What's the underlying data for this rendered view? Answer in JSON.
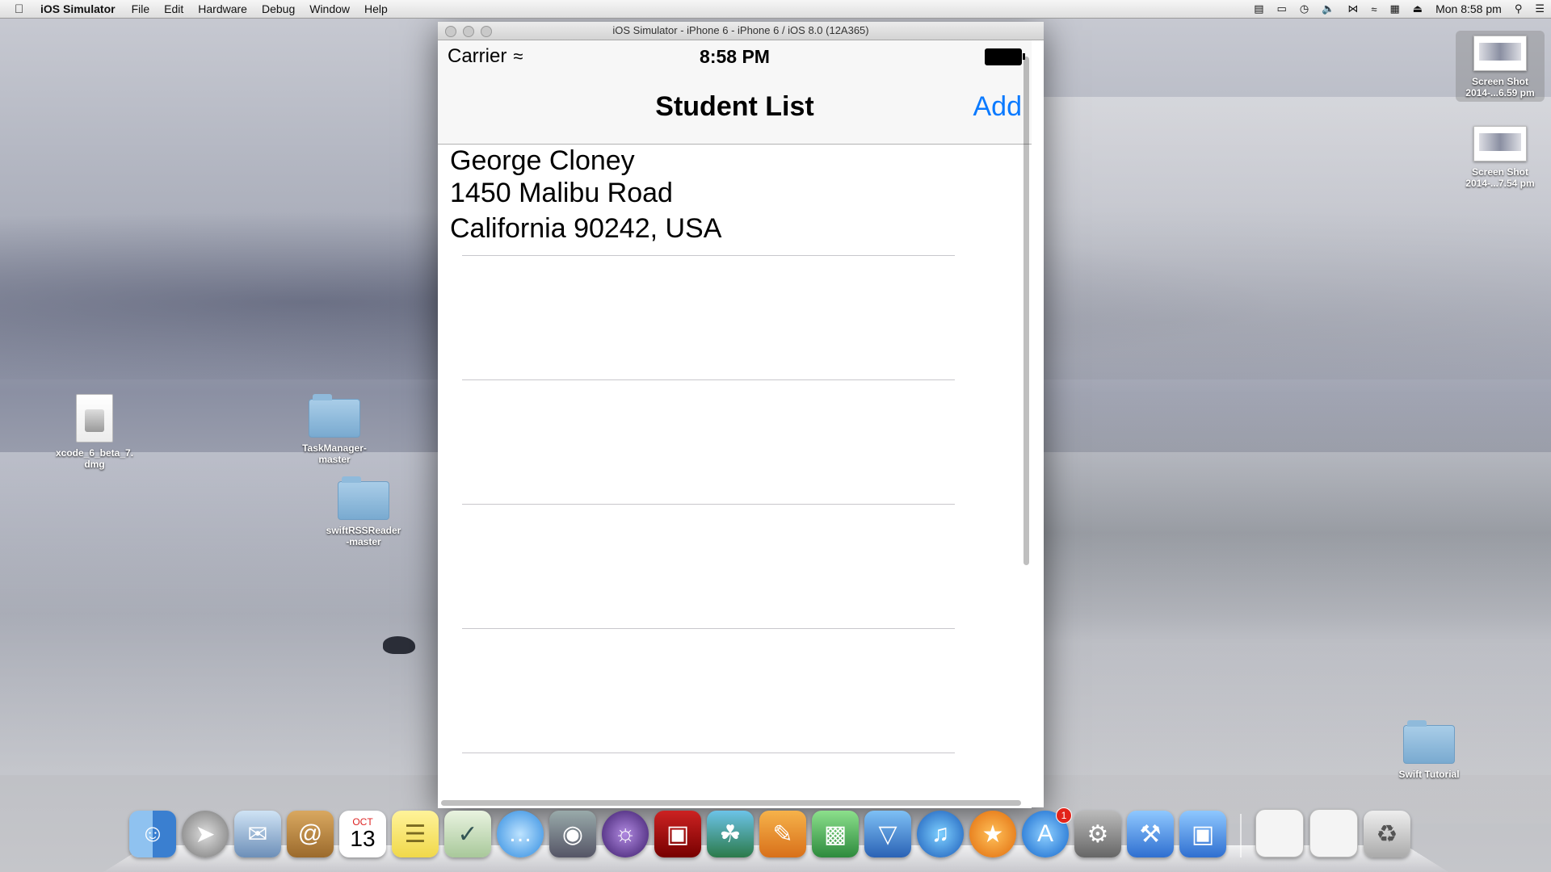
{
  "menubar": {
    "app_name": "iOS Simulator",
    "menus": [
      "File",
      "Edit",
      "Hardware",
      "Debug",
      "Window",
      "Help"
    ],
    "clock": "Mon 8:58 pm",
    "status_icons": [
      "display-icon",
      "airplay-icon",
      "time-machine-icon",
      "volume-icon",
      "bluetooth-icon",
      "wifi-icon",
      "input-menu-icon",
      "eject-icon"
    ]
  },
  "desktop": {
    "icons": [
      {
        "label_line1": "xcode_6_beta_7.",
        "label_line2": "dmg",
        "kind": "dmg-file-icon"
      },
      {
        "label_line1": "TaskManager-",
        "label_line2": "master",
        "kind": "folder-icon"
      },
      {
        "label_line1": "swiftRSSReader",
        "label_line2": "-master",
        "kind": "folder-icon"
      },
      {
        "label_line1": "Swift Tutorial",
        "label_line2": "",
        "kind": "folder-icon"
      },
      {
        "label_line1": "Screen Shot",
        "label_line2": "2014-...6.59 pm",
        "kind": "screenshot-icon"
      },
      {
        "label_line1": "Screen Shot",
        "label_line2": "2014-...7.54 pm",
        "kind": "screenshot-icon"
      }
    ]
  },
  "simulator": {
    "window_title": "iOS Simulator - iPhone 6 - iPhone 6 / iOS 8.0 (12A365)",
    "status_bar": {
      "carrier": "Carrier",
      "time": "8:58 PM"
    },
    "nav": {
      "title": "Student List",
      "add_label": "Add"
    },
    "students": [
      {
        "name": "George Cloney",
        "street": "1450 Malibu Road",
        "region": "California 90242, USA"
      }
    ]
  },
  "dock": {
    "apps": [
      "finder-icon",
      "launchpad-icon",
      "mail-icon",
      "contacts-icon",
      "calendar-icon",
      "notes-icon",
      "reminders-icon",
      "messages-icon",
      "facetime-icon",
      "eclipse-icon",
      "photo-booth-icon",
      "iphoto-icon",
      "pages-icon",
      "numbers-icon",
      "keynote-icon",
      "itunes-icon",
      "ibooks-icon",
      "app-store-icon",
      "system-preferences-icon",
      "xcode-icon",
      "simulator-icon"
    ],
    "calendar_month": "OCT",
    "calendar_day": "13",
    "app_store_badge": "1"
  }
}
